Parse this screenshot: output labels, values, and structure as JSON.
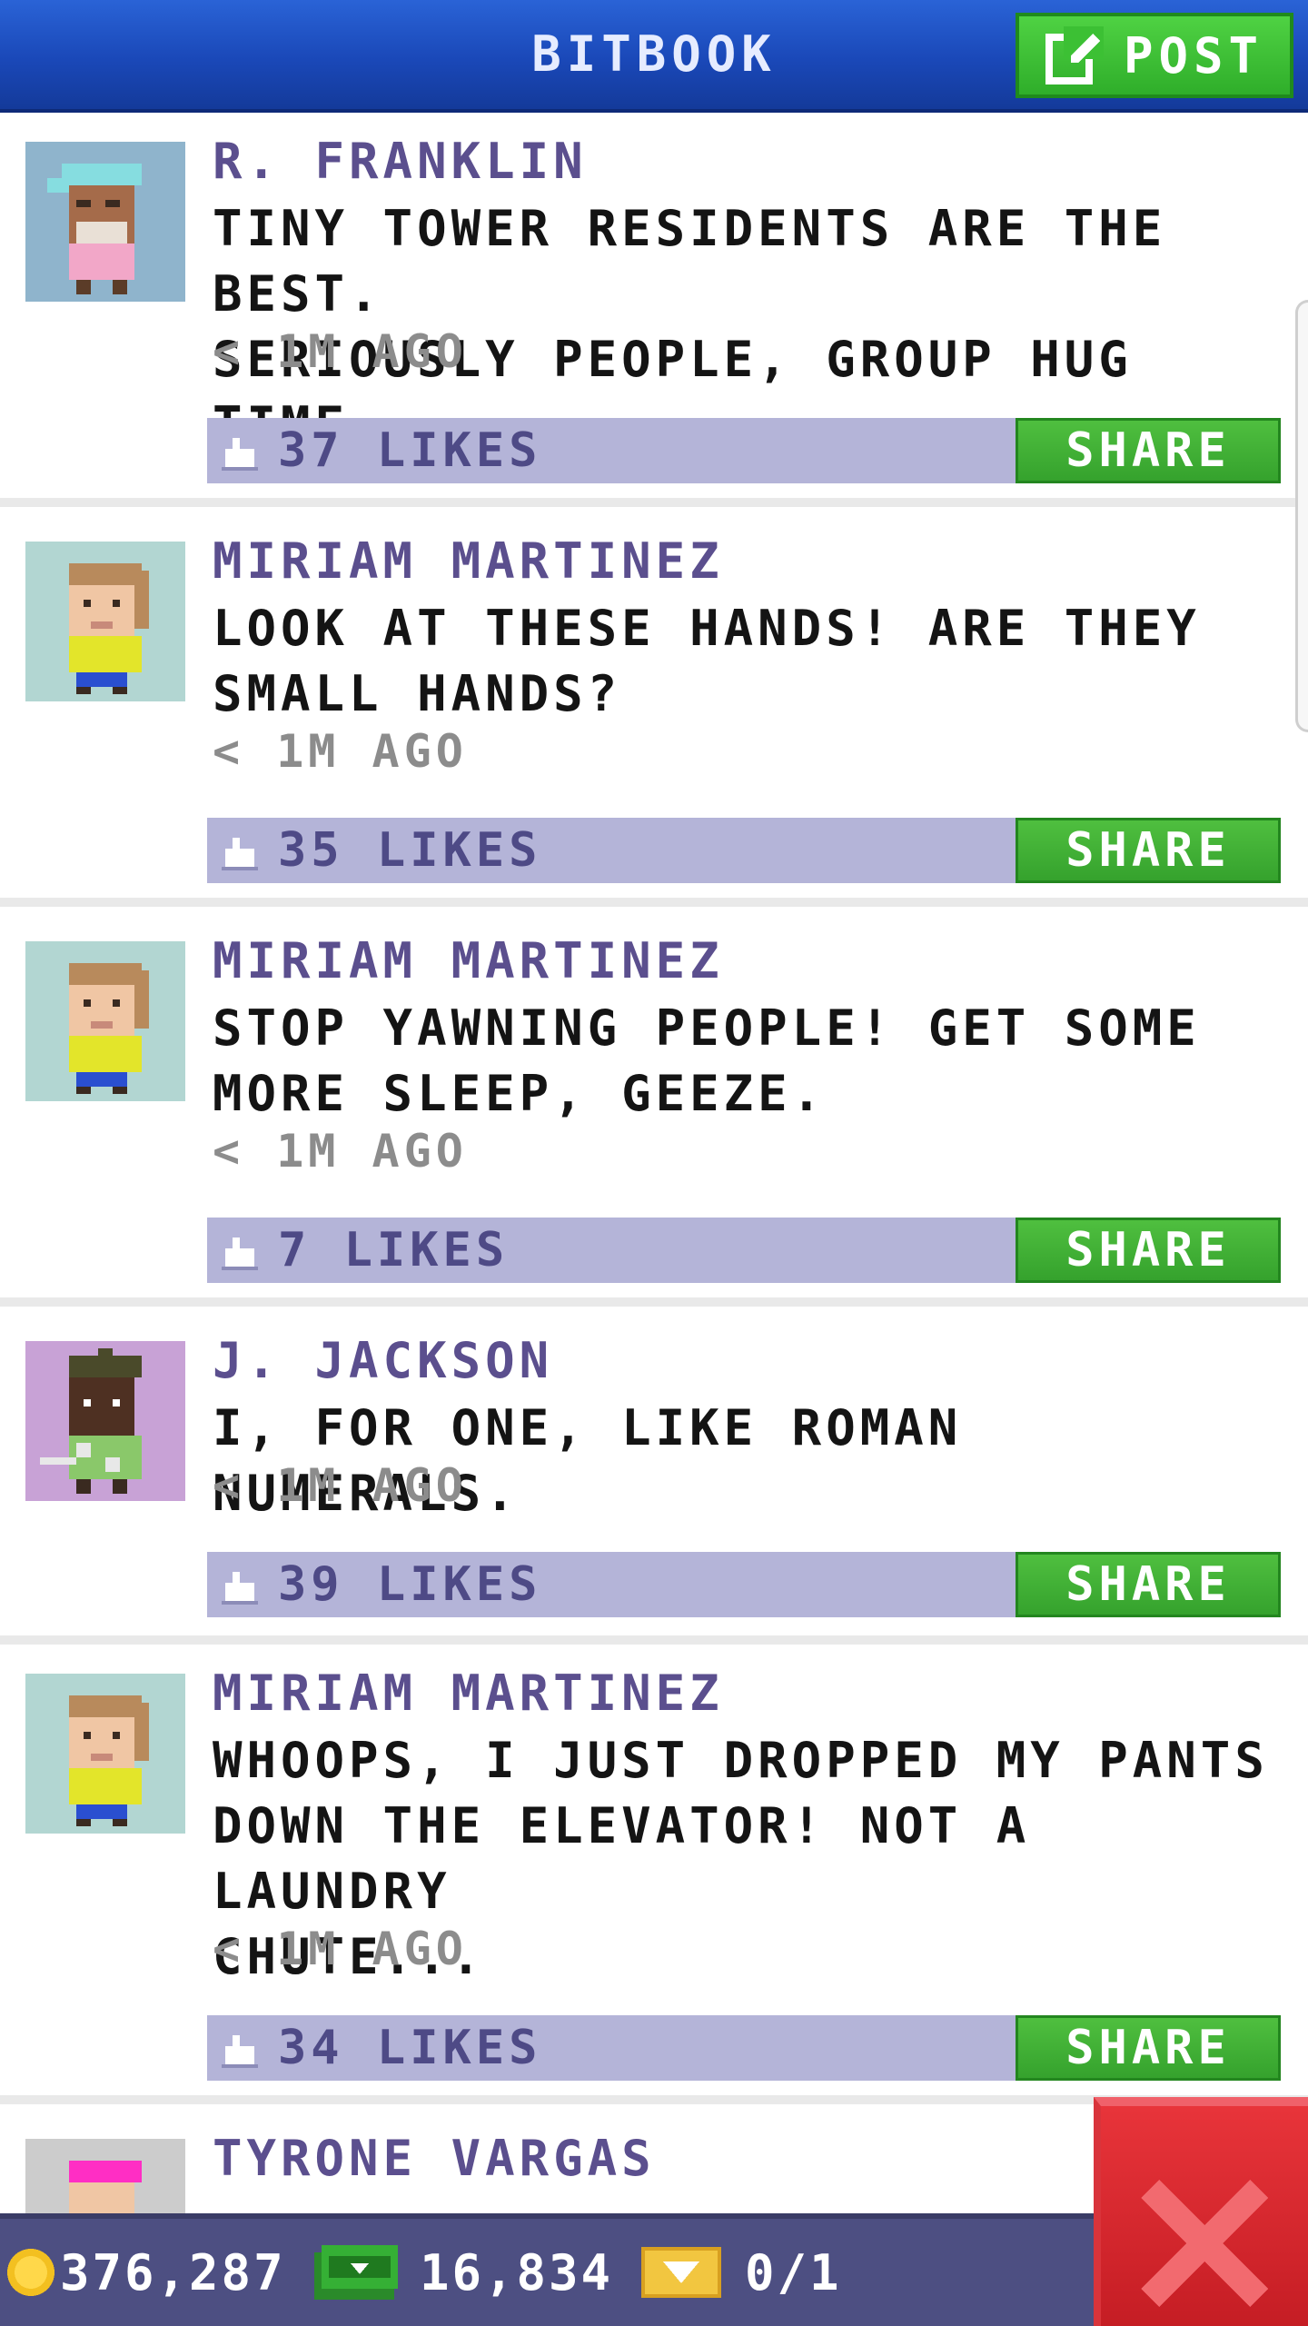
{
  "header": {
    "title": "BITBOOK",
    "post_label": "POST"
  },
  "posts": [
    {
      "name": "R. FRANKLIN",
      "lines": [
        "TINY TOWER RESIDENTS ARE THE BEST.",
        "SERIOUSLY PEOPLE, GROUP HUG TIME."
      ],
      "time": "< 1M AGO",
      "likes": "37 LIKES",
      "share": "SHARE",
      "avatar": "bitizen-cap-pink"
    },
    {
      "name": "MIRIAM MARTINEZ",
      "lines": [
        "LOOK AT THESE HANDS! ARE THEY",
        "SMALL HANDS?"
      ],
      "time": "< 1M AGO",
      "likes": "35 LIKES",
      "share": "SHARE",
      "avatar": "bitizen-yellow"
    },
    {
      "name": "MIRIAM MARTINEZ",
      "lines": [
        "STOP YAWNING PEOPLE! GET SOME",
        "MORE SLEEP, GEEZE."
      ],
      "time": "< 1M AGO",
      "likes": "7 LIKES",
      "share": "SHARE",
      "avatar": "bitizen-yellow"
    },
    {
      "name": "J. JACKSON",
      "lines": [
        "I, FOR ONE, LIKE ROMAN NUMERALS."
      ],
      "time": "< 1M AGO",
      "likes": "39 LIKES",
      "share": "SHARE",
      "avatar": "bitizen-golfer"
    },
    {
      "name": "MIRIAM MARTINEZ",
      "lines": [
        "WHOOPS, I JUST DROPPED MY PANTS",
        "DOWN THE ELEVATOR! NOT A LAUNDRY",
        "CHUTE..."
      ],
      "time": "< 1M AGO",
      "likes": "34 LIKES",
      "share": "SHARE",
      "avatar": "bitizen-yellow"
    },
    {
      "name": "TYRONE VARGAS",
      "avatar": "bitizen-pink-hair"
    }
  ],
  "status": {
    "coins": "376,287",
    "bux": "16,834",
    "tickets": "0/1"
  },
  "icons": {
    "post": "edit-icon",
    "like": "thumbs-up-icon",
    "coin": "coin-icon",
    "bux": "bux-icon",
    "ticket": "vip-ticket-icon",
    "close": "close-icon"
  },
  "colors": {
    "header_blue": "#1a48b8",
    "name_purple": "#5b4f8e",
    "likebar": "#b4b4d8",
    "share_green": "#35a22d",
    "close_red": "#c51d24",
    "status_bg": "#4d4f82"
  }
}
